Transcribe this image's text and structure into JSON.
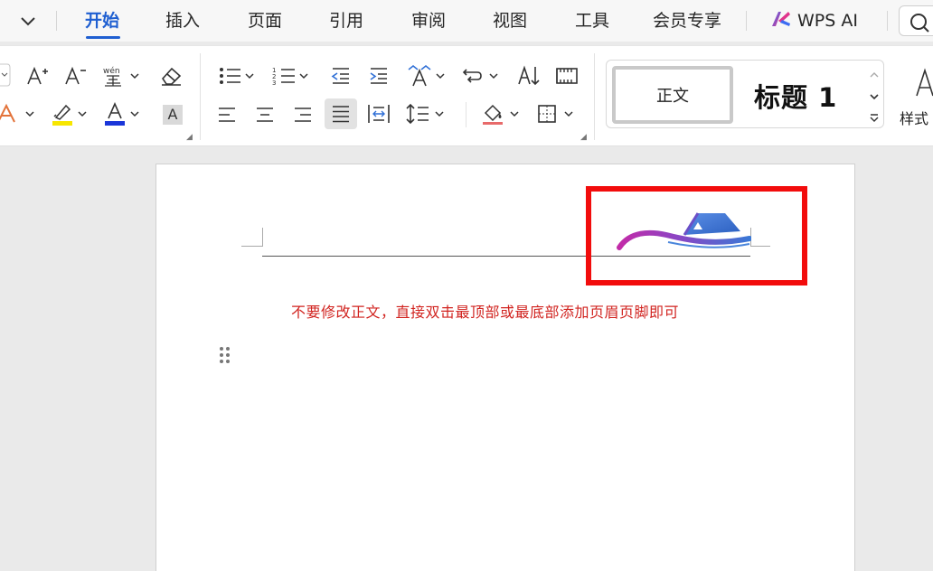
{
  "tabs": [
    "开始",
    "插入",
    "页面",
    "引用",
    "审阅",
    "视图",
    "工具",
    "会员专享"
  ],
  "active_tab": "开始",
  "wps_ai_label": "WPS AI",
  "ribbon": {
    "style_gallery": {
      "normal_label": "正文",
      "heading1_label": "标题 1"
    },
    "styles_button_label": "样式",
    "shading_letter": "A"
  },
  "document": {
    "instruction_text": "不要修改正文，直接双击最顶部或最底部添加页眉页脚即可"
  },
  "colors": {
    "accent": "#1f5fd1",
    "highlight": "#f7e600",
    "font_color": "#1a36d9",
    "annotation_box": "#f20c0c",
    "instruction_text": "#d1231f",
    "logo_blue": "#3a78d6",
    "logo_purple": "#a13fc0"
  }
}
